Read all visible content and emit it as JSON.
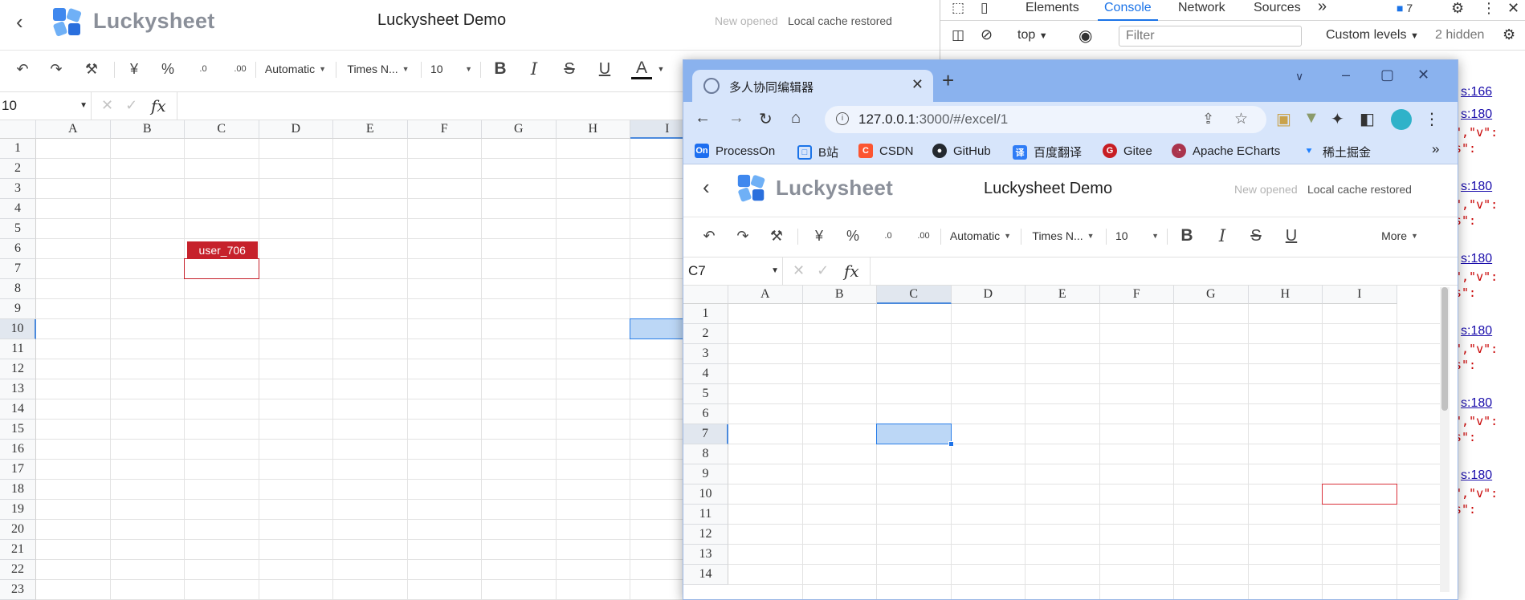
{
  "app": {
    "brand": "Luckysheet",
    "title": "Luckysheet Demo",
    "status_new": "New opened",
    "status_cache": "Local cache restored",
    "toolbar": {
      "format_label": "Automatic",
      "font_label": "Times N...",
      "size_label": "10",
      "currency_glyph": "¥",
      "percent_glyph": "%",
      "dec_increase": ".0",
      "dec_decrease": ".00",
      "bold": "B",
      "italic": "I",
      "strike": "S",
      "underline": "U",
      "text_color": "A",
      "more_label": "More"
    },
    "formula": {
      "fx": "fx"
    },
    "columns": [
      "A",
      "B",
      "C",
      "D",
      "E",
      "F",
      "G",
      "H",
      "I"
    ],
    "rows": [
      "1",
      "2",
      "3",
      "4",
      "5",
      "6",
      "7",
      "8",
      "9",
      "10",
      "11",
      "12",
      "13",
      "14",
      "15",
      "16",
      "17",
      "18",
      "19",
      "20",
      "21",
      "22",
      "23"
    ]
  },
  "back_sheet": {
    "namebox": "10",
    "remote_user": "user_706",
    "remote_user_color": "#c6212b",
    "selection_color": "#2a7ee8"
  },
  "browser": {
    "tab_title": "多人协同编辑器",
    "url_host": "127.0.0.1",
    "url_rest": ":3000/#/excel/1",
    "bookmarks": [
      "ProcessOn",
      "B站",
      "CSDN",
      "GitHub",
      "百度翻译",
      "Gitee",
      "Apache ECharts",
      "稀土掘金"
    ],
    "bookmark_more": "»",
    "front_sheet": {
      "namebox": "C7",
      "rows": [
        "1",
        "2",
        "3",
        "4",
        "5",
        "6",
        "7",
        "8",
        "9",
        "10",
        "11",
        "12",
        "13",
        "14"
      ]
    }
  },
  "devtools": {
    "tabs": [
      "Elements",
      "Console",
      "Network",
      "Sources"
    ],
    "active_tab": "Console",
    "more_tabs": "»",
    "issues_count": "7",
    "context": "top",
    "filter_placeholder": "Filter",
    "levels": "Custom levels",
    "hidden": "2 hidden",
    "links": [
      "s:166",
      "s:180",
      "s:180",
      "s:180",
      "s:180",
      "s:180",
      "s:180"
    ],
    "code_line1": "\",\"v\":",
    "code_line2": "s\":"
  }
}
